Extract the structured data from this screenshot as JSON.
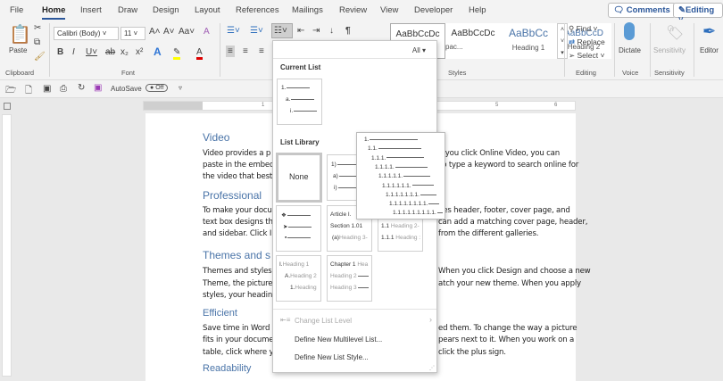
{
  "menu": {
    "tabs": [
      "File",
      "Home",
      "Insert",
      "Draw",
      "Design",
      "Layout",
      "References",
      "Mailings",
      "Review",
      "View",
      "Developer",
      "Help"
    ],
    "comments": "Comments",
    "editing": "Editing"
  },
  "ribbon": {
    "paste": "Paste",
    "font_name": "Calibri (Body)",
    "font_size": "11",
    "groups": {
      "clipboard": "Clipboard",
      "font": "Font",
      "styles": "Styles",
      "editing": "Editing",
      "voice": "Voice",
      "sensitivity": "Sensitivity"
    },
    "styles": [
      {
        "preview": "AaBbCcDc",
        "name": ""
      },
      {
        "preview": "AaBbCcDc",
        "name": "pac..."
      },
      {
        "preview": "AaBbCc",
        "name": "Heading 1"
      },
      {
        "preview": "AaBbCcD",
        "name": "Heading 2"
      }
    ],
    "find": "Find",
    "replace": "Replace",
    "select": "Select",
    "dictate": "Dictate",
    "sensitivity": "Sensitivity",
    "editor": "Editor"
  },
  "qat": {
    "autosave": "AutoSave",
    "toggle": "Off"
  },
  "ruler": {
    "marks": [
      "1",
      "5",
      "6"
    ]
  },
  "document": {
    "headings": [
      "Video",
      "Professional",
      "Themes and s",
      "Efficient",
      "Readability"
    ],
    "lines": [
      {
        "l": "Video provides a p",
        "r": "n you click Online Video, you can"
      },
      {
        "l": "paste in the embed",
        "r": "so type a keyword to search online for"
      },
      {
        "l": "the video that best",
        "r": ""
      },
      {
        "l": "To make your docu",
        "r": "des header, footer, cover page, and"
      },
      {
        "l": "text box designs th",
        "r": "can add a matching cover page, header,"
      },
      {
        "l": "and sidebar. Click I",
        "r": "from the different galleries."
      },
      {
        "l": "Themes and styles",
        "r": "When you click Design and choose a new"
      },
      {
        "l": "Theme, the picture",
        "r": "atch your new theme. When you apply"
      },
      {
        "l": "styles, your headin",
        "r": ""
      },
      {
        "l": "Save time in Word",
        "r": "ed them. To change the way a picture"
      },
      {
        "l": "fits in your docume",
        "r": "pears next to it. When you work on a"
      },
      {
        "l": "table, click where y",
        "r": "click the plus sign."
      }
    ]
  },
  "dropdown": {
    "filter": "All",
    "current_list": "Current List",
    "current": [
      "1.",
      "a.",
      "i."
    ],
    "list_library": "List Library",
    "none": "None",
    "lib2": [
      "1)",
      "a)",
      "i)"
    ],
    "article": [
      "Article I.",
      "Section 1.01",
      "(a)",
      "Heading 3-"
    ],
    "heading_num": [
      "1.1",
      "Heading 2-",
      "1.1.1",
      "Heading :"
    ],
    "roman": [
      "I.",
      "Heading 1",
      "A.",
      "Heading 2",
      "1.",
      "Heading"
    ],
    "chapter": [
      "Chapter 1",
      "Hea",
      "Heading 2",
      "Heading 3"
    ],
    "change_level": "Change List Level",
    "define_multilevel": "Define New Multilevel List...",
    "define_style": "Define New List Style..."
  },
  "preview": [
    "1.",
    "1.1.",
    "1.1.1.",
    "1.1.1.1.",
    "1.1.1.1.1.",
    "1.1.1.1.1.1.",
    "1.1.1.1.1.1.1.",
    "1.1.1.1.1.1.1.1.",
    "1.1.1.1.1.1.1.1.1."
  ]
}
